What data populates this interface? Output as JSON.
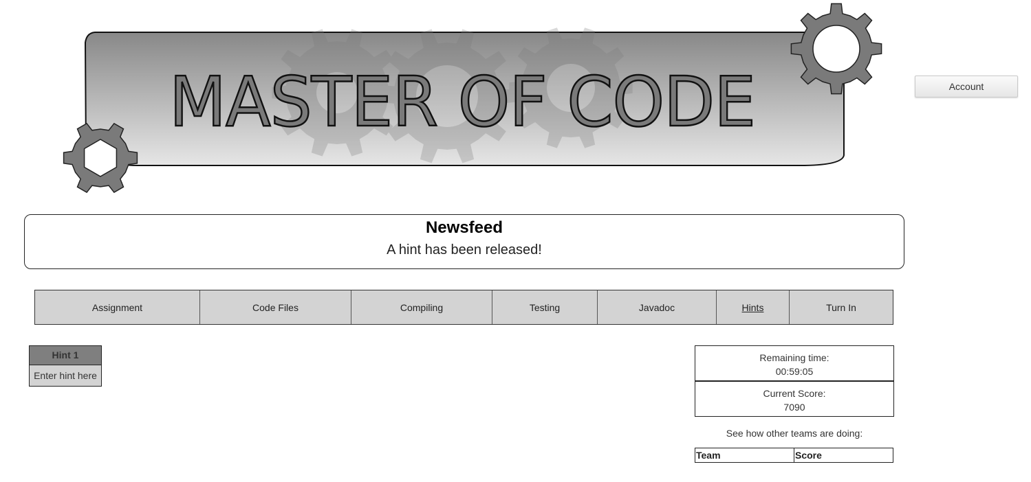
{
  "header": {
    "logo_text": "MASTER OF CODE",
    "account_label": "Account"
  },
  "newsfeed": {
    "title": "Newsfeed",
    "message": "A hint has been released!"
  },
  "tabs": [
    {
      "label": "Assignment"
    },
    {
      "label": "Code Files"
    },
    {
      "label": "Compiling"
    },
    {
      "label": "Testing"
    },
    {
      "label": "Javadoc"
    },
    {
      "label": "Hints",
      "active": true
    },
    {
      "label": "Turn In"
    }
  ],
  "hint": {
    "title": "Hint 1",
    "placeholder": "Enter hint here"
  },
  "status": {
    "remaining_label": "Remaining time:",
    "remaining_value": "00:59:05",
    "score_label": "Current Score:",
    "score_value": "7090",
    "teams_label": "See how other teams are doing:",
    "table_headers": [
      "Team",
      "Score"
    ]
  },
  "colors": {
    "banner_dark": "#8c8c8c",
    "banner_light": "#e6e6e6",
    "gear": "#7a7a7a",
    "tab_bg": "#d3d3d3",
    "hint_header_bg": "#7f7f7f"
  }
}
